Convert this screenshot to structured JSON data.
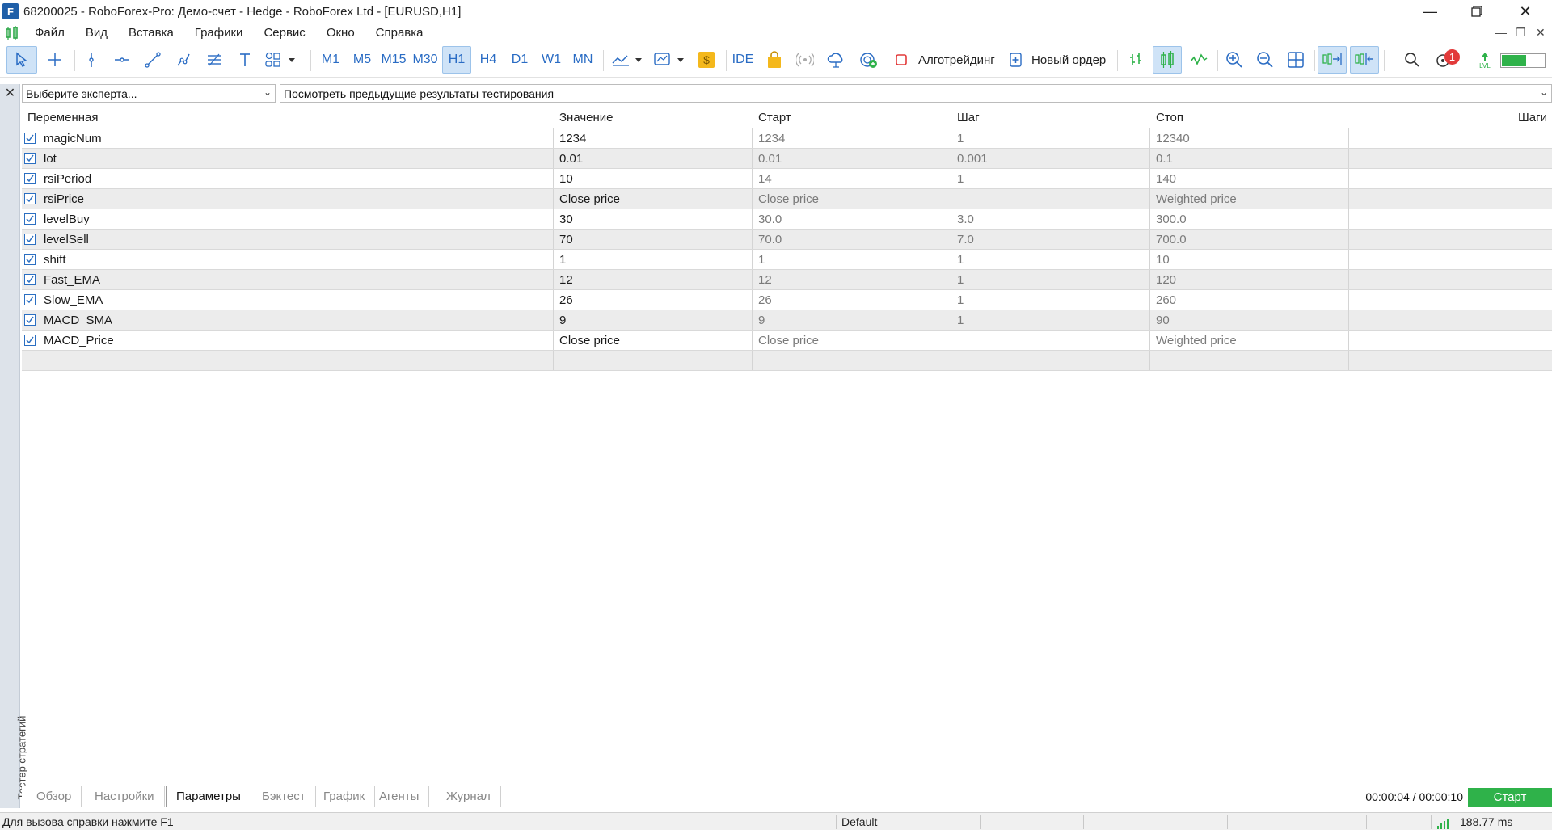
{
  "window": {
    "title": "68200025 - RoboForex-Pro: Демо-счет - Hedge - RoboForex Ltd - [EURUSD,H1]",
    "app_icon": "chart-app-icon",
    "controls": [
      "minimize-icon",
      "restore-icon",
      "close-icon"
    ]
  },
  "menu": {
    "items": [
      "Файл",
      "Вид",
      "Вставка",
      "Графики",
      "Сервис",
      "Окно",
      "Справка"
    ]
  },
  "toolbar": {
    "timeframes": [
      "M1",
      "M5",
      "M15",
      "M30",
      "H1",
      "H4",
      "D1",
      "W1",
      "MN"
    ],
    "active_timeframe": "H1",
    "ide_label": "IDE",
    "algotrading_label": "Алготрейдинг",
    "new_order_label": "Новый ордер",
    "notification_count": "1",
    "lvl_label": "LVL"
  },
  "tester": {
    "expert_placeholder": "Выберите эксперта...",
    "history_placeholder": "Посмотреть предыдущие результаты тестирования",
    "sidebar_label": "Тестер стратегий"
  },
  "table": {
    "headers": [
      "Переменная",
      "Значение",
      "Старт",
      "Шаг",
      "Стоп",
      "Шаги"
    ],
    "rows": [
      {
        "name": "magicNum",
        "value": "1234",
        "start": "1234",
        "step": "1",
        "stop": "12340",
        "checked": true
      },
      {
        "name": "lot",
        "value": "0.01",
        "start": "0.01",
        "step": "0.001",
        "stop": "0.1",
        "checked": true
      },
      {
        "name": "rsiPeriod",
        "value": "10",
        "start": "14",
        "step": "1",
        "stop": "140",
        "checked": true
      },
      {
        "name": "rsiPrice",
        "value": "Close price",
        "start": "Close price",
        "step": "",
        "stop": "Weighted price",
        "checked": true
      },
      {
        "name": "levelBuy",
        "value": "30",
        "start": "30.0",
        "step": "3.0",
        "stop": "300.0",
        "checked": true
      },
      {
        "name": "levelSell",
        "value": "70",
        "start": "70.0",
        "step": "7.0",
        "stop": "700.0",
        "checked": true
      },
      {
        "name": "shift",
        "value": "1",
        "start": "1",
        "step": "1",
        "stop": "10",
        "checked": true
      },
      {
        "name": "Fast_EMA",
        "value": "12",
        "start": "12",
        "step": "1",
        "stop": "120",
        "checked": true
      },
      {
        "name": "Slow_EMA",
        "value": "26",
        "start": "26",
        "step": "1",
        "stop": "260",
        "checked": true
      },
      {
        "name": "MACD_SMA",
        "value": "9",
        "start": "9",
        "step": "1",
        "stop": "90",
        "checked": true
      },
      {
        "name": "MACD_Price",
        "value": "Close price",
        "start": "Close price",
        "step": "",
        "stop": "Weighted price",
        "checked": true
      }
    ]
  },
  "bottom_tabs": {
    "items": [
      "Обзор",
      "Настройки",
      "Параметры",
      "Бэктест",
      "График",
      "Агенты",
      "Журнал"
    ],
    "active": "Параметры",
    "elapsed": "00:00:04 / 00:00:10",
    "start_label": "Старт"
  },
  "status": {
    "help": "Для вызова справки нажмите F1",
    "profile": "Default",
    "ping": "188.77 ms"
  },
  "colors": {
    "accent": "#2a6cc4",
    "active_tab_bg": "#cfe3f7",
    "start_button": "#2fb24a",
    "row_alt": "#ececec"
  }
}
